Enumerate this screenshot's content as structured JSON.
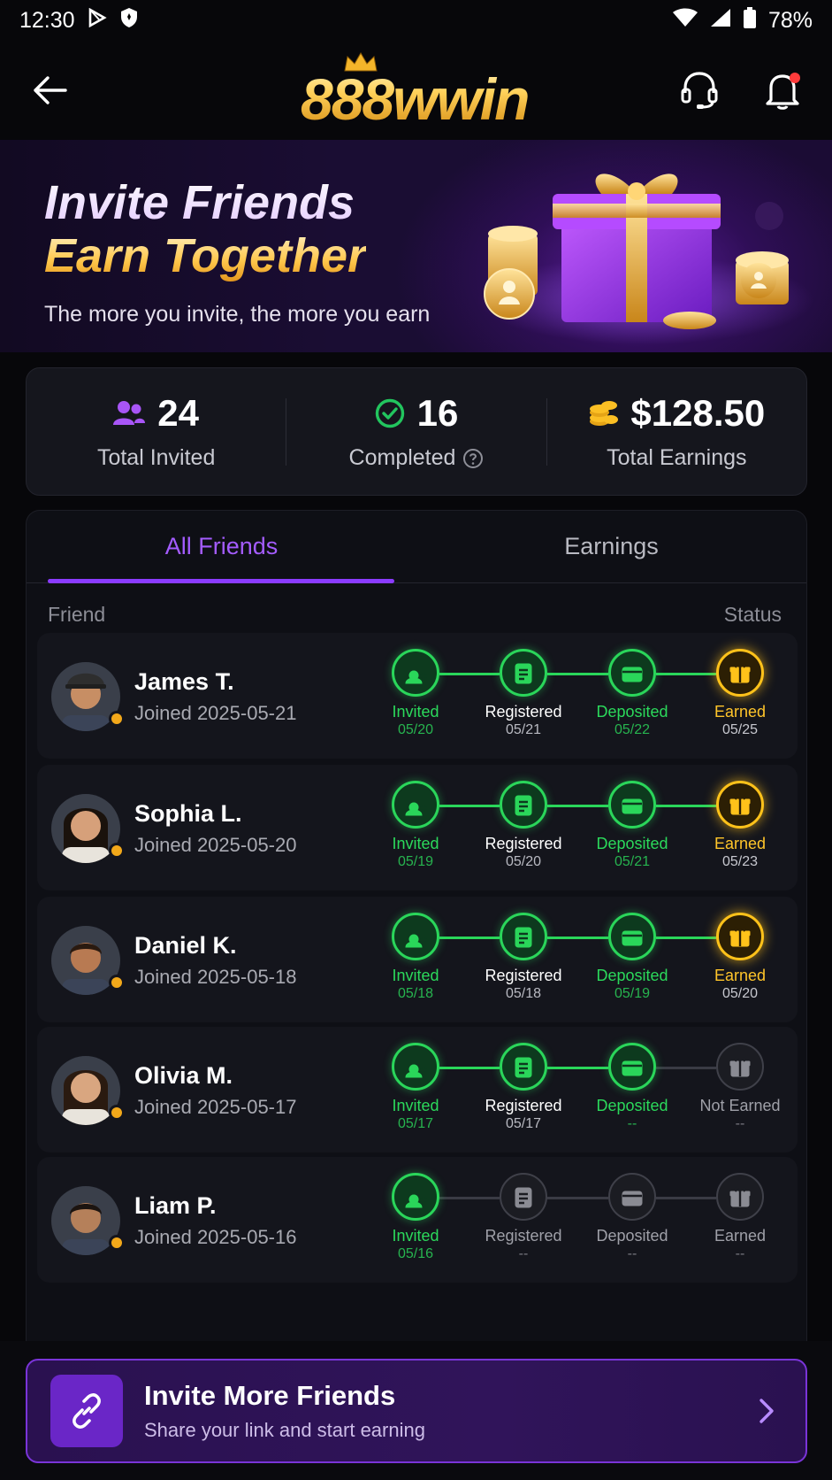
{
  "status_bar": {
    "time": "12:30",
    "battery": "78%"
  },
  "header": {
    "logo": "888wwin"
  },
  "hero": {
    "title_line1": "Invite Friends",
    "title_line2": "Earn Together",
    "subtitle": "The more you invite, the more you earn"
  },
  "stats": [
    {
      "icon": "users-icon",
      "value": "24",
      "label": "Total Invited",
      "color": "#a855f7"
    },
    {
      "icon": "check-circle-icon",
      "value": "16",
      "label": "Completed",
      "color": "#22c55e"
    },
    {
      "icon": "coins-icon",
      "value": "$128.50",
      "label": "Total Earnings",
      "color": "#fbbf24"
    }
  ],
  "tabs": {
    "all_friends": "All Friends",
    "earnings": "Earnings"
  },
  "list_header": {
    "friend": "Friend",
    "status": "Status"
  },
  "friends": [
    {
      "name": "James T.",
      "joined": "Joined 2025-05-21",
      "steps": [
        {
          "label": "Invited",
          "date": "05/20",
          "state": "done"
        },
        {
          "label": "Registered",
          "date": "05/21",
          "state": "done"
        },
        {
          "label": "Deposited",
          "date": "05/22",
          "state": "done"
        },
        {
          "label": "Earned",
          "date": "05/25",
          "state": "earned"
        }
      ]
    },
    {
      "name": "Sophia L.",
      "joined": "Joined 2025-05-20",
      "steps": [
        {
          "label": "Invited",
          "date": "05/19",
          "state": "done"
        },
        {
          "label": "Registered",
          "date": "05/20",
          "state": "done"
        },
        {
          "label": "Deposited",
          "date": "05/21",
          "state": "done"
        },
        {
          "label": "Earned",
          "date": "05/23",
          "state": "earned"
        }
      ]
    },
    {
      "name": "Daniel K.",
      "joined": "Joined 2025-05-18",
      "steps": [
        {
          "label": "Invited",
          "date": "05/18",
          "state": "done"
        },
        {
          "label": "Registered",
          "date": "05/18",
          "state": "done"
        },
        {
          "label": "Deposited",
          "date": "05/19",
          "state": "done"
        },
        {
          "label": "Earned",
          "date": "05/20",
          "state": "earned"
        }
      ]
    },
    {
      "name": "Olivia M.",
      "joined": "Joined 2025-05-17",
      "steps": [
        {
          "label": "Invited",
          "date": "05/17",
          "state": "done"
        },
        {
          "label": "Registered",
          "date": "05/17",
          "state": "done"
        },
        {
          "label": "Deposited",
          "date": "--",
          "state": "done"
        },
        {
          "label": "Not Earned",
          "date": "--",
          "state": "pending"
        }
      ]
    },
    {
      "name": "Liam P.",
      "joined": "Joined 2025-05-16",
      "steps": [
        {
          "label": "Invited",
          "date": "05/16",
          "state": "done"
        },
        {
          "label": "Registered",
          "date": "--",
          "state": "pending"
        },
        {
          "label": "Deposited",
          "date": "--",
          "state": "pending"
        },
        {
          "label": "Earned",
          "date": "--",
          "state": "pending"
        }
      ]
    }
  ],
  "invite_cta": {
    "title": "Invite More Friends",
    "subtitle": "Share your link and start earning"
  },
  "colors": {
    "accent": "#8b3bff",
    "green": "#2ad65a",
    "gold": "#ffc21a",
    "background": "#07070a"
  }
}
